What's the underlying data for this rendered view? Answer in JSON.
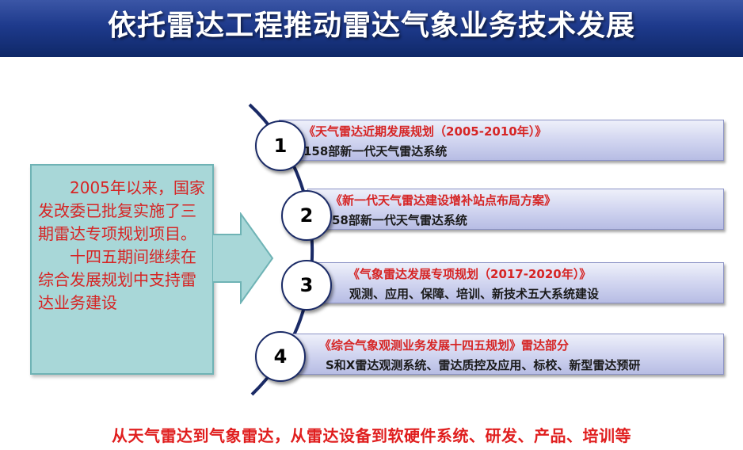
{
  "header": {
    "title": "依托雷达工程推动雷达气象业务技术发展"
  },
  "left_box": {
    "paragraph1": "2005年以来，国家发改委已批复实施了三期雷达专项规划项目。",
    "paragraph2": "十四五期间继续在综合发展规划中支持雷达业务建设"
  },
  "items": [
    {
      "number": "1",
      "title": "《天气雷达近期发展规划（2005-2010年）》",
      "desc": "158部新一代天气雷达系统"
    },
    {
      "number": "2",
      "title": "《新一代天气雷达建设增补站点布局方案》",
      "desc": "58部新一代天气雷达系统"
    },
    {
      "number": "3",
      "title": "《气象雷达发展专项规划（2017-2020年）》",
      "desc": "观测、应用、保障、培训、新技术五大系统建设"
    },
    {
      "number": "4",
      "title": "《综合气象观测业务发展十四五规划》雷达部分",
      "desc": "S和X雷达观测系统、雷达质控及应用、标校、新型雷达预研"
    }
  ],
  "footer": {
    "text": "从天气雷达到气象雷达，从雷达设备到软硬件系统、研发、产品、培训等"
  }
}
